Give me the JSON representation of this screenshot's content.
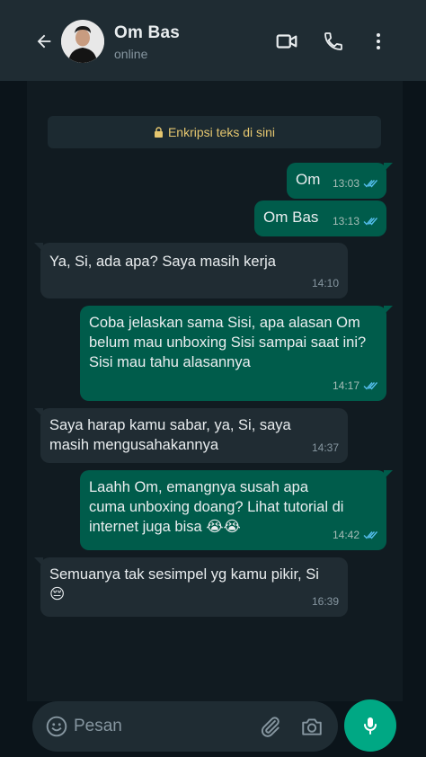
{
  "header": {
    "contact_name": "Om Bas",
    "status": "online"
  },
  "encryption_notice": "Enkripsi teks di sini",
  "messages": [
    {
      "direction": "out",
      "text": "Om",
      "time": "13:03",
      "read": true
    },
    {
      "direction": "out",
      "text": "Om Bas",
      "time": "13:13",
      "read": true
    },
    {
      "direction": "in",
      "text": "Ya, Si, ada apa? Saya masih kerja",
      "time": "14:10"
    },
    {
      "direction": "out",
      "text": "Coba jelaskan sama Sisi, apa alasan Om belum mau unboxing Sisi sampai saat ini? Sisi mau tahu alasannya",
      "time": "14:17",
      "read": true
    },
    {
      "direction": "in",
      "text": "Saya harap kamu sabar, ya, Si, saya masih mengusahakannya",
      "time": "14:37"
    },
    {
      "direction": "out",
      "text": "Laahh Om, emangnya susah apa cuma unboxing doang? Lihat tutorial di internet juga bisa 😭😭",
      "time": "14:42",
      "read": true
    },
    {
      "direction": "in",
      "text": "Semuanya tak sesimpel yg kamu pikir, Si 😔",
      "time": "16:39"
    }
  ],
  "composer": {
    "placeholder": "Pesan"
  },
  "colors": {
    "outgoing_bubble": "#005c4b",
    "incoming_bubble": "#202c33",
    "read_ticks": "#53bdeb",
    "accent": "#00a884"
  },
  "icons": [
    "back-arrow-icon",
    "video-call-icon",
    "phone-icon",
    "more-vert-icon",
    "lock-icon",
    "emoji-icon",
    "attach-icon",
    "camera-icon",
    "mic-icon"
  ]
}
